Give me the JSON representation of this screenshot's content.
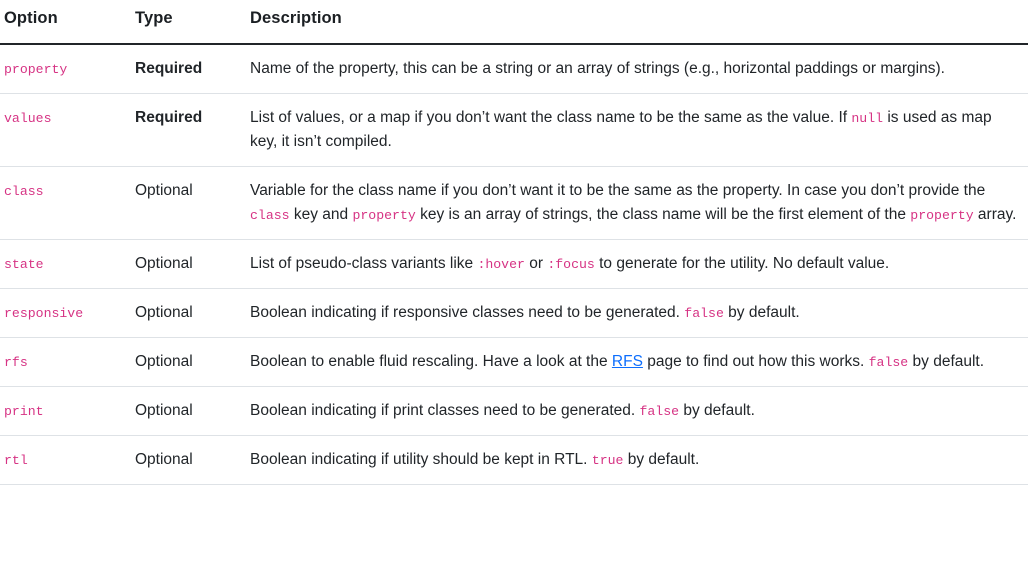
{
  "table": {
    "columns": [
      {
        "key": "option",
        "label": "Option"
      },
      {
        "key": "type",
        "label": "Type"
      },
      {
        "key": "description",
        "label": "Description"
      }
    ],
    "rows": [
      {
        "option": "property",
        "type": "Required",
        "description_parts": [
          {
            "kind": "text",
            "text": "Name of the property, this can be a string or an array of strings (e.g., horizontal paddings or margins)."
          }
        ]
      },
      {
        "option": "values",
        "type": "Required",
        "description_parts": [
          {
            "kind": "text",
            "text": "List of values, or a map if you don’t want the class name to be the same as the value. If "
          },
          {
            "kind": "code",
            "text": "null"
          },
          {
            "kind": "text",
            "text": " is used as map key, it isn’t compiled."
          }
        ]
      },
      {
        "option": "class",
        "type": "Optional",
        "description_parts": [
          {
            "kind": "text",
            "text": "Variable for the class name if you don’t want it to be the same as the property. In case you don’t provide the "
          },
          {
            "kind": "code",
            "text": "class"
          },
          {
            "kind": "text",
            "text": " key and "
          },
          {
            "kind": "code",
            "text": "property"
          },
          {
            "kind": "text",
            "text": " key is an array of strings, the class name will be the first element of the "
          },
          {
            "kind": "code",
            "text": "property"
          },
          {
            "kind": "text",
            "text": " array."
          }
        ]
      },
      {
        "option": "state",
        "type": "Optional",
        "description_parts": [
          {
            "kind": "text",
            "text": "List of pseudo-class variants like "
          },
          {
            "kind": "code",
            "text": ":hover"
          },
          {
            "kind": "text",
            "text": " or "
          },
          {
            "kind": "code",
            "text": ":focus"
          },
          {
            "kind": "text",
            "text": " to generate for the utility. No default value."
          }
        ]
      },
      {
        "option": "responsive",
        "type": "Optional",
        "description_parts": [
          {
            "kind": "text",
            "text": "Boolean indicating if responsive classes need to be generated. "
          },
          {
            "kind": "code",
            "text": "false"
          },
          {
            "kind": "text",
            "text": " by default."
          }
        ]
      },
      {
        "option": "rfs",
        "type": "Optional",
        "description_parts": [
          {
            "kind": "text",
            "text": "Boolean to enable fluid rescaling. Have a look at the "
          },
          {
            "kind": "link",
            "text": "RFS"
          },
          {
            "kind": "text",
            "text": " page to find out how this works. "
          },
          {
            "kind": "code",
            "text": "false"
          },
          {
            "kind": "text",
            "text": " by default."
          }
        ]
      },
      {
        "option": "print",
        "type": "Optional",
        "description_parts": [
          {
            "kind": "text",
            "text": "Boolean indicating if print classes need to be generated. "
          },
          {
            "kind": "code",
            "text": "false"
          },
          {
            "kind": "text",
            "text": " by default."
          }
        ]
      },
      {
        "option": "rtl",
        "type": "Optional",
        "description_parts": [
          {
            "kind": "text",
            "text": "Boolean indicating if utility should be kept in RTL. "
          },
          {
            "kind": "code",
            "text": "true"
          },
          {
            "kind": "text",
            "text": " by default."
          }
        ]
      }
    ]
  },
  "colors": {
    "code_text": "#d63384",
    "link": "#0d6efd",
    "body_text": "#212529",
    "header_border": "#212529",
    "row_border": "#dee2e6",
    "background": "#ffffff"
  }
}
